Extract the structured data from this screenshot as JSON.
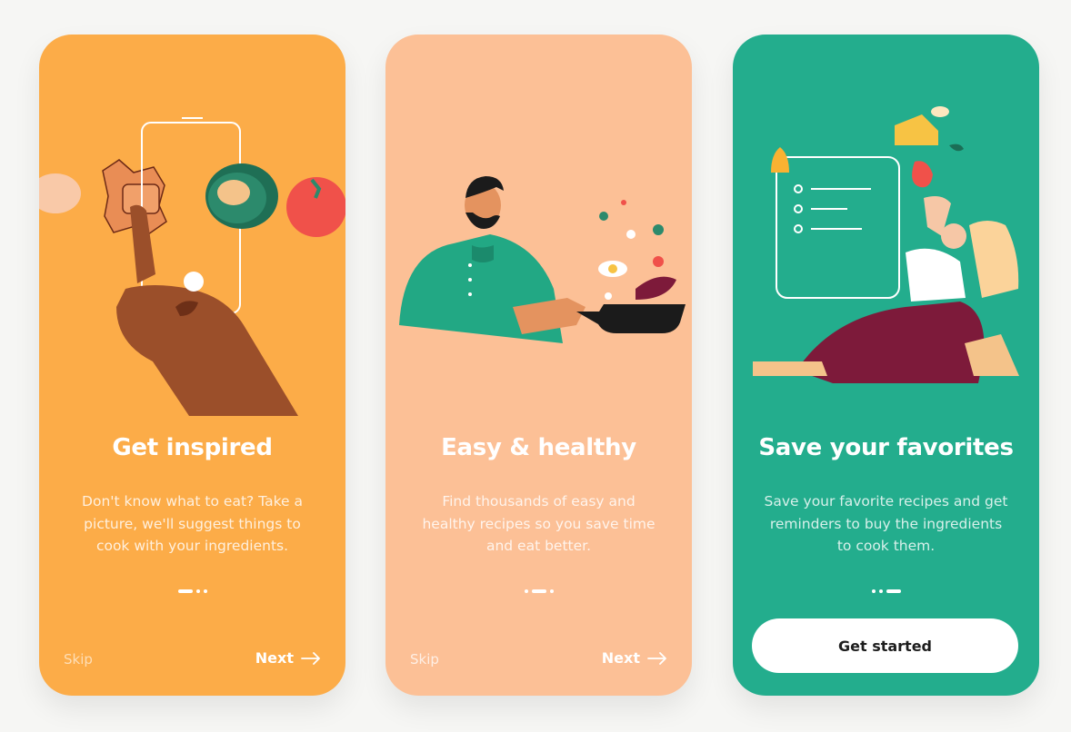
{
  "screens": [
    {
      "title": "Get inspired",
      "description": "Don't know what to eat? Take a picture, we'll suggest things to cook with your ingredients.",
      "skip_label": "Skip",
      "next_label": "Next",
      "active_dot": 1,
      "background": "#fcac48"
    },
    {
      "title": "Easy & healthy",
      "description": "Find thousands of easy and healthy recipes so you save time and eat better.",
      "skip_label": "Skip",
      "next_label": "Next",
      "active_dot": 2,
      "background": "#fcc096"
    },
    {
      "title": "Save your favorites",
      "description": "Save your favorite recipes and get reminders to buy the ingredients to cook them.",
      "cta_label": "Get started",
      "active_dot": 3,
      "background": "#23ad8d"
    }
  ],
  "icons": {
    "next": "arrow-right-icon"
  },
  "colors": {
    "white": "#ffffff",
    "chef_green": "#22a884",
    "pan": "#1b1b1b",
    "avocado": "#2c8a6c",
    "tomato": "#f0514a",
    "skin_dark": "#7a3f24",
    "pants": "#7d1a3a"
  }
}
